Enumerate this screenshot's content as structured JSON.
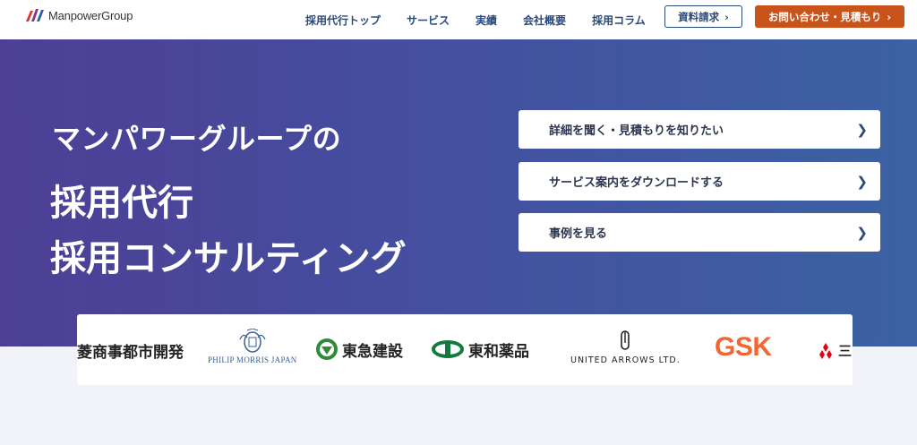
{
  "header": {
    "logo_text": "ManpowerGroup",
    "nav": [
      "採用代行トップ",
      "サービス",
      "実績",
      "会社概要",
      "採用コラム"
    ],
    "doc_button": "資料請求",
    "contact_button": "お問い合わせ・見積もり"
  },
  "hero": {
    "subtitle": "マンパワーグループの",
    "title_line1": "採用代行",
    "title_line2": "採用コンサルティング"
  },
  "cta": [
    {
      "label": "詳細を聞く・見積もりを知りたい"
    },
    {
      "label": "サービス案内をダウンロードする"
    },
    {
      "label": "事例を見る"
    }
  ],
  "client_logos": {
    "mitsubishi_estate": "菱商事都市開発",
    "philip_morris": "PHILIP MORRIS JAPAN",
    "tokyu": "東急建設",
    "towa": "東和薬品",
    "united_arrows": "UNITED ARROWS LTD.",
    "gsk": "GSK",
    "mitsubishi_partial": "三"
  },
  "colors": {
    "nav_text": "#2b4a7c",
    "contact_orange": "#c8541c",
    "gsk_orange": "#f36633",
    "hero_left": "#4d3f95",
    "hero_right": "#3c62a3",
    "mitsubishi_red": "#e60012",
    "tokyu_green": "#2e8b3a",
    "towa_green": "#127a3c"
  }
}
